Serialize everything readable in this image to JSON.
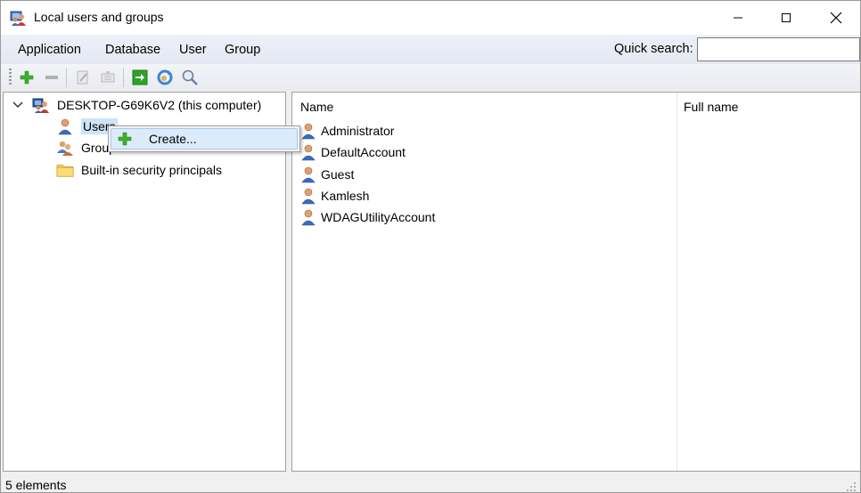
{
  "window": {
    "title": "Local users and groups",
    "icon": "users-app-icon"
  },
  "menu": {
    "application": "Application",
    "database": "Database",
    "user": "User",
    "group": "Group"
  },
  "quick_search": {
    "label": "Quick search:",
    "value": "",
    "placeholder": ""
  },
  "toolbar": {
    "icons": [
      "add-icon",
      "remove-icon",
      "edit-icon",
      "properties-icon",
      "go-icon",
      "refresh-icon",
      "search-icon"
    ]
  },
  "tree": {
    "root": "DESKTOP-G69K6V2 (this computer)",
    "users": "Users",
    "groups": "Groups",
    "builtin": "Built-in security principals"
  },
  "list": {
    "columns": [
      "Name",
      "Full name"
    ],
    "rows": [
      {
        "name": "Administrator",
        "full_name": ""
      },
      {
        "name": "DefaultAccount",
        "full_name": ""
      },
      {
        "name": "Guest",
        "full_name": ""
      },
      {
        "name": "Kamlesh",
        "full_name": ""
      },
      {
        "name": "WDAGUtilityAccount",
        "full_name": ""
      }
    ]
  },
  "context_menu": {
    "create": "Create..."
  },
  "status": {
    "text": "5 elements"
  },
  "colors": {
    "selection": "#cce4f7",
    "menu_highlight": "#dcebfa",
    "add_green": "#3fae2a"
  }
}
